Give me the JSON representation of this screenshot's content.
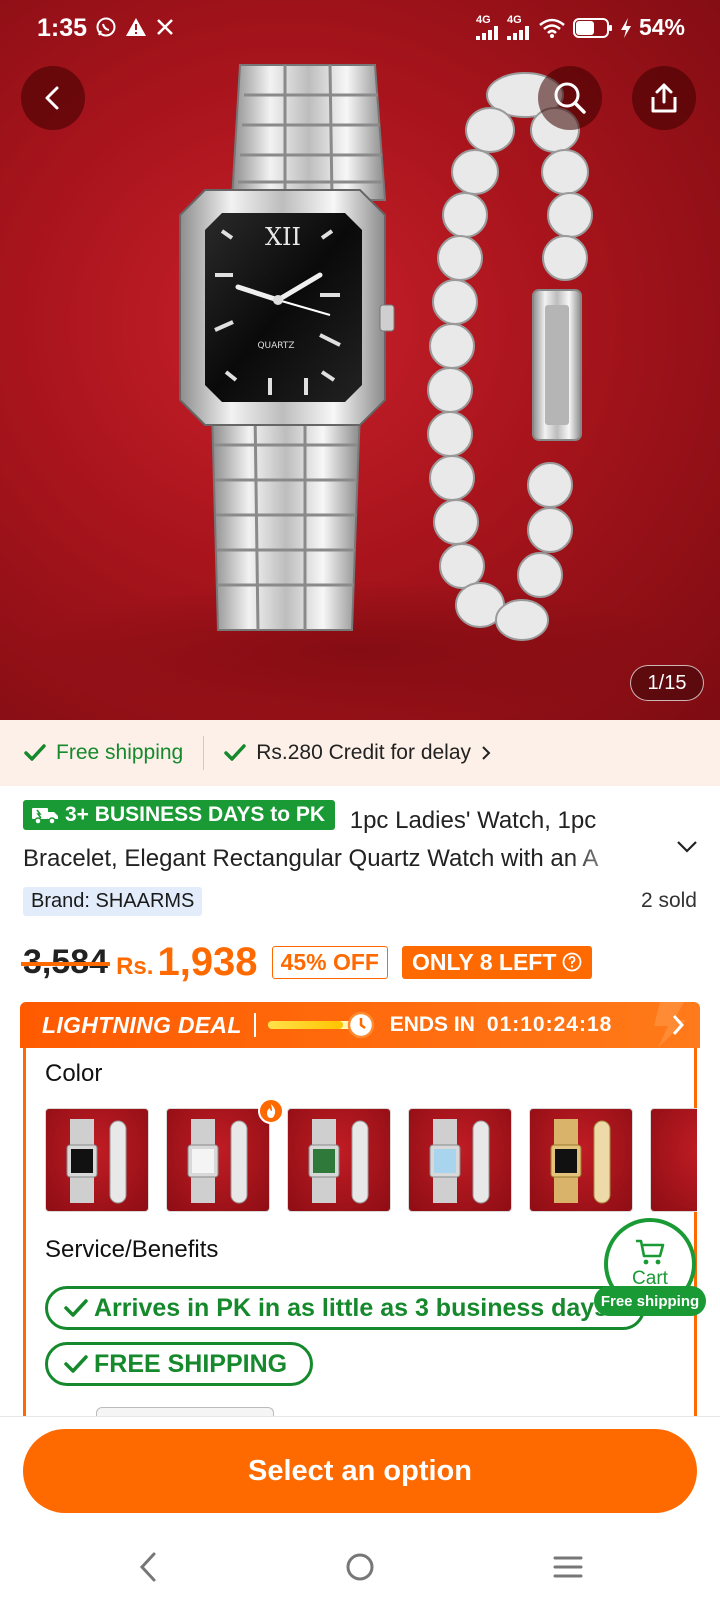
{
  "status_bar": {
    "time": "1:35",
    "network1": "4G",
    "network2": "4G",
    "battery": "54%"
  },
  "hero": {
    "counter": "1/15",
    "watch_face_text": "QUARTZ",
    "watch_numeral": "XII"
  },
  "shipping_strip": {
    "free_shipping": "Free shipping",
    "credit": "Rs.280 Credit for delay"
  },
  "product": {
    "delivery_badge": "3+ BUSINESS DAYS to PK",
    "title_line1": "1pc Ladies' Watch, 1pc",
    "title_line2": "Bracelet, Elegant Rectangular Quartz Watch with an A",
    "brand": "Brand: SHAARMS",
    "sold": "2 sold",
    "old_price": "3,584",
    "currency": "Rs.",
    "price": "1,938",
    "discount": "45% OFF",
    "stock": "ONLY 8 LEFT"
  },
  "deal": {
    "title": "LIGHTNING DEAL",
    "progress": 0.78,
    "ends_label": "ENDS IN",
    "timer": "01:10:24:18"
  },
  "options": {
    "color_label": "Color",
    "swatches": [
      "black",
      "white",
      "green",
      "light-blue",
      "gold-black"
    ],
    "service_label": "Service/Benefits",
    "benefit1": "Arrives in PK in as little as 3 business days",
    "benefit2": "FREE SHIPPING"
  },
  "cart": {
    "label": "Cart",
    "free_shipping_tag": "Free shipping"
  },
  "cta": {
    "label": "Select an option"
  },
  "colors": {
    "accent": "#ff6a00",
    "green": "#1a9a35",
    "hero_red": "#b0161e"
  }
}
